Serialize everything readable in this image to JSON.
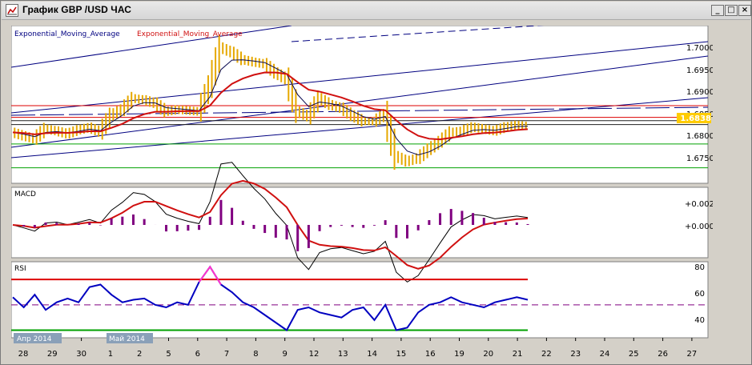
{
  "window": {
    "title": "График GBP /USD  ЧАС",
    "minimize_glyph": "_",
    "maximize_glyph": "□",
    "close_glyph": "×"
  },
  "colors": {
    "background": "#ffffff",
    "price_bars": "#e6a800",
    "ema_fast": "#0a0a50",
    "ema_slow": "#d01010",
    "trendline": "#000080",
    "level_red": "#dd0000",
    "level_green": "#00a000",
    "macd_hist": "#800080",
    "rsi_line": "#0000c0",
    "rsi_extreme": "#ff33cc",
    "rsi_mid": "#800080",
    "current_price_bg": "#ffcc00"
  },
  "price_panel": {
    "legend_ema_1": "Exponential_Moving_Average",
    "legend_ema_2": "Exponential_Moving_Average",
    "y_ticks": [
      "1.7000",
      "1.6950",
      "1.6900",
      "1.6850",
      "1.6800",
      "1.6750"
    ],
    "y_range": [
      1.672,
      1.7045
    ],
    "current_price": "1.6838",
    "red_level": 1.688,
    "green_levels": [
      1.6801,
      1.6752
    ],
    "horizontal_guides": [
      1.6856,
      1.6849,
      1.6841
    ],
    "close_series": [
      1.6825,
      1.6818,
      1.6812,
      1.6832,
      1.6828,
      1.6822,
      1.683,
      1.6835,
      1.6826,
      1.686,
      1.6872,
      1.6895,
      1.6892,
      1.6885,
      1.6868,
      1.6872,
      1.687,
      1.6868,
      1.6922,
      1.7,
      1.699,
      1.6975,
      1.697,
      1.6966,
      1.6948,
      1.6935,
      1.6868,
      1.6858,
      1.6895,
      1.6882,
      1.6875,
      1.686,
      1.6848,
      1.6848,
      1.6862,
      1.6776,
      1.6765,
      1.6772,
      1.679,
      1.6806,
      1.6825,
      1.6828,
      1.6836,
      1.6832,
      1.6828,
      1.6836,
      1.684,
      1.6838
    ]
  },
  "macd_panel": {
    "label": "MACD",
    "y_ticks": [
      "+0.002",
      "+0.000"
    ]
  },
  "rsi_panel": {
    "label": "RSI",
    "y_ticks": [
      "80",
      "60",
      "40"
    ],
    "y_range": [
      24,
      84
    ],
    "upper_level": 70,
    "lower_level": 30,
    "mid_level": 50,
    "rsi_series": [
      56,
      48,
      58,
      46,
      52,
      55,
      52,
      64,
      66,
      58,
      52,
      54,
      55,
      50,
      48,
      52,
      50,
      68,
      80,
      66,
      60,
      52,
      48,
      42,
      36,
      30,
      46,
      48,
      44,
      42,
      40,
      46,
      48,
      38,
      50,
      30,
      32,
      44,
      50,
      52,
      56,
      52,
      50,
      48,
      52,
      54,
      56,
      54
    ]
  },
  "x_axis": {
    "labels": [
      "28",
      "29",
      "30",
      "1",
      "2",
      "5",
      "6",
      "7",
      "8",
      "9",
      "12",
      "13",
      "14",
      "15",
      "16",
      "19",
      "20",
      "21",
      "22",
      "23",
      "24",
      "25",
      "26",
      "27"
    ],
    "period_tags": [
      "Апр 2014",
      "Май 2014"
    ]
  }
}
